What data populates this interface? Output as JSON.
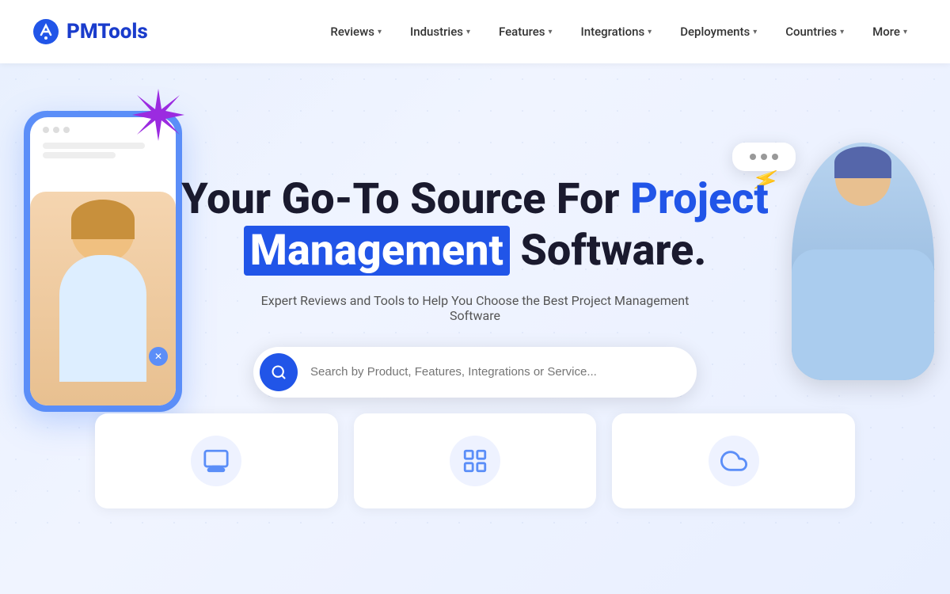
{
  "brand": {
    "name": "PMTools",
    "logo_icon": "⬡"
  },
  "nav": {
    "links": [
      {
        "label": "Reviews",
        "has_dropdown": true,
        "name": "reviews"
      },
      {
        "label": "Industries",
        "has_dropdown": true,
        "name": "industries"
      },
      {
        "label": "Features",
        "has_dropdown": true,
        "name": "features"
      },
      {
        "label": "Integrations",
        "has_dropdown": true,
        "name": "integrations"
      },
      {
        "label": "Deployments",
        "has_dropdown": true,
        "name": "deployments"
      },
      {
        "label": "Countries",
        "has_dropdown": true,
        "name": "countries"
      },
      {
        "label": "More",
        "has_dropdown": true,
        "name": "more"
      }
    ]
  },
  "hero": {
    "title_part1": "Your Go-To Source For",
    "title_blue": "Project",
    "title_highlight": "Management",
    "title_part3": "Software.",
    "subtitle": "Expert Reviews and Tools to Help You Choose the Best Project Management Software",
    "search_placeholder": "Search by Product, Features, Integrations or Service..."
  },
  "cards": [
    {
      "icon": "🖥",
      "name": "card-1"
    },
    {
      "icon": "📊",
      "name": "card-2"
    },
    {
      "icon": "☁",
      "name": "card-3"
    }
  ],
  "colors": {
    "accent": "#2155e8",
    "star": "#9b2be0"
  }
}
